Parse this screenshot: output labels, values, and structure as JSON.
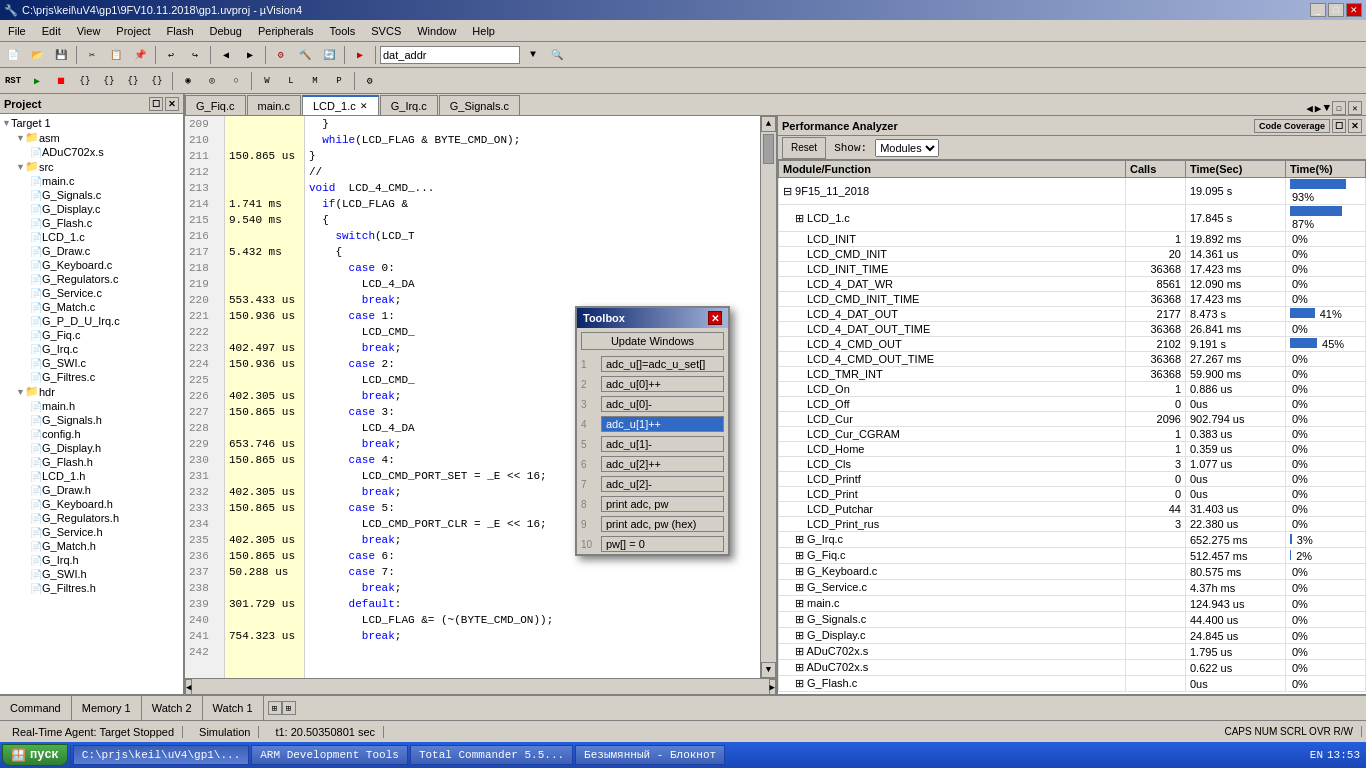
{
  "title": "C:\\prjs\\keil\\uV4\\gp1\\9FV10.11.2018\\gp1.uvproj - µVision4",
  "menu": {
    "items": [
      "File",
      "Edit",
      "View",
      "Project",
      "Flash",
      "Debug",
      "Peripherals",
      "Tools",
      "SVCS",
      "Window",
      "Help"
    ]
  },
  "toolbar1": {
    "combo_value": "dat_addr"
  },
  "project_panel": {
    "title": "Project",
    "tree": [
      {
        "indent": 0,
        "type": "target",
        "label": "Target 1",
        "expanded": true
      },
      {
        "indent": 1,
        "type": "folder",
        "label": "asm",
        "expanded": true
      },
      {
        "indent": 2,
        "type": "file",
        "label": "ADuC702x.s"
      },
      {
        "indent": 1,
        "type": "folder",
        "label": "src",
        "expanded": true
      },
      {
        "indent": 2,
        "type": "file",
        "label": "main.c"
      },
      {
        "indent": 2,
        "type": "file",
        "label": "G_Signals.c"
      },
      {
        "indent": 2,
        "type": "file",
        "label": "G_Display.c"
      },
      {
        "indent": 2,
        "type": "file",
        "label": "G_Flash.c"
      },
      {
        "indent": 2,
        "type": "file",
        "label": "LCD_1.c"
      },
      {
        "indent": 2,
        "type": "file",
        "label": "G_Draw.c"
      },
      {
        "indent": 2,
        "type": "file",
        "label": "G_Keyboard.c"
      },
      {
        "indent": 2,
        "type": "file",
        "label": "G_Regulators.c"
      },
      {
        "indent": 2,
        "type": "file",
        "label": "G_Service.c"
      },
      {
        "indent": 2,
        "type": "file",
        "label": "G_Match.c"
      },
      {
        "indent": 2,
        "type": "file",
        "label": "G_P_D_U_Irq.c"
      },
      {
        "indent": 2,
        "type": "file",
        "label": "G_Fiq.c"
      },
      {
        "indent": 2,
        "type": "file",
        "label": "G_Irq.c"
      },
      {
        "indent": 2,
        "type": "file",
        "label": "G_SWI.c"
      },
      {
        "indent": 2,
        "type": "file",
        "label": "G_Filtres.c"
      },
      {
        "indent": 1,
        "type": "folder",
        "label": "hdr",
        "expanded": true
      },
      {
        "indent": 2,
        "type": "file",
        "label": "main.h"
      },
      {
        "indent": 2,
        "type": "file",
        "label": "G_Signals.h"
      },
      {
        "indent": 2,
        "type": "file",
        "label": "config.h"
      },
      {
        "indent": 2,
        "type": "file",
        "label": "G_Display.h"
      },
      {
        "indent": 2,
        "type": "file",
        "label": "G_Flash.h"
      },
      {
        "indent": 2,
        "type": "file",
        "label": "LCD_1.h"
      },
      {
        "indent": 2,
        "type": "file",
        "label": "G_Draw.h"
      },
      {
        "indent": 2,
        "type": "file",
        "label": "G_Keyboard.h"
      },
      {
        "indent": 2,
        "type": "file",
        "label": "G_Regulators.h"
      },
      {
        "indent": 2,
        "type": "file",
        "label": "G_Service.h"
      },
      {
        "indent": 2,
        "type": "file",
        "label": "G_Match.h"
      },
      {
        "indent": 2,
        "type": "file",
        "label": "G_Irq.h"
      },
      {
        "indent": 2,
        "type": "file",
        "label": "G_SWI.h"
      },
      {
        "indent": 2,
        "type": "file",
        "label": "G_Filtres.h"
      }
    ]
  },
  "tabs": [
    {
      "label": "G_Fiq.c",
      "active": false
    },
    {
      "label": "main.c",
      "active": false
    },
    {
      "label": "LCD_1.c",
      "active": true
    },
    {
      "label": "G_Irq.c",
      "active": false
    },
    {
      "label": "G_Signals.c",
      "active": false
    }
  ],
  "code": {
    "lines": [
      {
        "num": "209",
        "time": "",
        "text": "  }"
      },
      {
        "num": "210",
        "time": "",
        "text": "  while(LCD_FLAG & BYTE_CMD_ON);"
      },
      {
        "num": "211",
        "time": "150.865 us",
        "text": "}"
      },
      {
        "num": "212",
        "time": "",
        "text": "//"
      },
      {
        "num": "213",
        "time": "",
        "text": "void  LCD_4_CMD_..."
      },
      {
        "num": "214",
        "time": "1.741 ms",
        "text": "  if(LCD_FLAG &"
      },
      {
        "num": "215",
        "time": "9.540 ms",
        "text": "  {"
      },
      {
        "num": "216",
        "time": "",
        "text": "    switch(LCD_T"
      },
      {
        "num": "217",
        "time": "5.432 ms",
        "text": "    {"
      },
      {
        "num": "218",
        "time": "",
        "text": "      case 0:"
      },
      {
        "num": "219",
        "time": "",
        "text": "        LCD_4_DA"
      },
      {
        "num": "220",
        "time": "553.433 us",
        "text": "        break;"
      },
      {
        "num": "221",
        "time": "150.936 us",
        "text": "      case 1:"
      },
      {
        "num": "222",
        "time": "",
        "text": "        LCD_CMD_"
      },
      {
        "num": "223",
        "time": "402.497 us",
        "text": "        break;"
      },
      {
        "num": "224",
        "time": "150.936 us",
        "text": "      case 2:"
      },
      {
        "num": "225",
        "time": "",
        "text": "        LCD_CMD_"
      },
      {
        "num": "226",
        "time": "402.305 us",
        "text": "        break;"
      },
      {
        "num": "227",
        "time": "150.865 us",
        "text": "      case 3:"
      },
      {
        "num": "228",
        "time": "",
        "text": "        LCD_4_DA"
      },
      {
        "num": "229",
        "time": "653.746 us",
        "text": "        break;"
      },
      {
        "num": "230",
        "time": "150.865 us",
        "text": "      case 4:"
      },
      {
        "num": "231",
        "time": "",
        "text": "        LCD_CMD_PORT_SET = _E << 16;"
      },
      {
        "num": "232",
        "time": "402.305 us",
        "text": "        break;"
      },
      {
        "num": "233",
        "time": "150.865 us",
        "text": "      case 5:"
      },
      {
        "num": "234",
        "time": "",
        "text": "        LCD_CMD_PORT_CLR = _E << 16;"
      },
      {
        "num": "235",
        "time": "402.305 us",
        "text": "        break;"
      },
      {
        "num": "236",
        "time": "150.865 us",
        "text": "      case 6:"
      },
      {
        "num": "237",
        "time": "50.288 us",
        "text": "      case 7:"
      },
      {
        "num": "238",
        "time": "",
        "text": "        break;"
      },
      {
        "num": "239",
        "time": "301.729 us",
        "text": "      default:"
      },
      {
        "num": "240",
        "time": "",
        "text": "        LCD_FLAG &= (~(BYTE_CMD_ON));"
      },
      {
        "num": "241",
        "time": "754.323 us",
        "text": "        break;"
      },
      {
        "num": "242",
        "time": "",
        "text": ""
      }
    ]
  },
  "toolbox": {
    "title": "Toolbox",
    "update_label": "Update Windows",
    "items": [
      {
        "num": "1",
        "label": "adc_u[]=adc_u_set[]"
      },
      {
        "num": "2",
        "label": "adc_u[0]++"
      },
      {
        "num": "3",
        "label": "adc_u[0]-"
      },
      {
        "num": "4",
        "label": "adc_u[1]++"
      },
      {
        "num": "5",
        "label": "adc_u[1]-"
      },
      {
        "num": "6",
        "label": "adc_u[2]++"
      },
      {
        "num": "7",
        "label": "adc_u[2]-"
      },
      {
        "num": "8",
        "label": "print adc, pw"
      },
      {
        "num": "9",
        "label": "print adc, pw (hex)"
      },
      {
        "num": "10",
        "label": "pw[] = 0"
      }
    ]
  },
  "perf": {
    "title": "Performance Analyzer",
    "show_label": "Show:",
    "show_value": "Modules",
    "reset_label": "Reset",
    "columns": [
      "Module/Function",
      "Calls",
      "Time(Sec)",
      "Time(%)"
    ],
    "rows": [
      {
        "indent": 0,
        "label": "9F15_11_2018",
        "calls": "",
        "time_sec": "19.095 s",
        "time_pct": "93%",
        "bar": 93
      },
      {
        "indent": 1,
        "label": "LCD_1.c",
        "calls": "",
        "time_sec": "17.845 s",
        "time_pct": "87%",
        "bar": 87
      },
      {
        "indent": 2,
        "label": "LCD_INIT",
        "calls": "1",
        "time_sec": "19.892 ms",
        "time_pct": "0%",
        "bar": 0
      },
      {
        "indent": 2,
        "label": "LCD_CMD_INIT",
        "calls": "20",
        "time_sec": "14.361 us",
        "time_pct": "0%",
        "bar": 0
      },
      {
        "indent": 2,
        "label": "LCD_INIT_TIME",
        "calls": "36368",
        "time_sec": "17.423 ms",
        "time_pct": "0%",
        "bar": 0
      },
      {
        "indent": 2,
        "label": "LCD_4_DAT_WR",
        "calls": "8561",
        "time_sec": "12.090 ms",
        "time_pct": "0%",
        "bar": 0
      },
      {
        "indent": 2,
        "label": "LCD_CMD_INIT_TIME",
        "calls": "36368",
        "time_sec": "17.423 ms",
        "time_pct": "0%",
        "bar": 0
      },
      {
        "indent": 2,
        "label": "LCD_4_DAT_OUT",
        "calls": "2177",
        "time_sec": "8.473 s",
        "time_pct": "41%",
        "bar": 41
      },
      {
        "indent": 2,
        "label": "LCD_4_DAT_OUT_TIME",
        "calls": "36368",
        "time_sec": "26.841 ms",
        "time_pct": "0%",
        "bar": 0
      },
      {
        "indent": 2,
        "label": "LCD_4_CMD_OUT",
        "calls": "2102",
        "time_sec": "9.191 s",
        "time_pct": "45%",
        "bar": 45
      },
      {
        "indent": 2,
        "label": "LCD_4_CMD_OUT_TIME",
        "calls": "36368",
        "time_sec": "27.267 ms",
        "time_pct": "0%",
        "bar": 0
      },
      {
        "indent": 2,
        "label": "LCD_TMR_INT",
        "calls": "36368",
        "time_sec": "59.900 ms",
        "time_pct": "0%",
        "bar": 0
      },
      {
        "indent": 2,
        "label": "LCD_On",
        "calls": "1",
        "time_sec": "0.886 us",
        "time_pct": "0%",
        "bar": 0
      },
      {
        "indent": 2,
        "label": "LCD_Off",
        "calls": "0",
        "time_sec": "0us",
        "time_pct": "0%",
        "bar": 0
      },
      {
        "indent": 2,
        "label": "LCD_Cur",
        "calls": "2096",
        "time_sec": "902.794 us",
        "time_pct": "0%",
        "bar": 0
      },
      {
        "indent": 2,
        "label": "LCD_Cur_CGRAM",
        "calls": "1",
        "time_sec": "0.383 us",
        "time_pct": "0%",
        "bar": 0
      },
      {
        "indent": 2,
        "label": "LCD_Home",
        "calls": "1",
        "time_sec": "0.359 us",
        "time_pct": "0%",
        "bar": 0
      },
      {
        "indent": 2,
        "label": "LCD_Cls",
        "calls": "3",
        "time_sec": "1.077 us",
        "time_pct": "0%",
        "bar": 0
      },
      {
        "indent": 2,
        "label": "LCD_Printf",
        "calls": "0",
        "time_sec": "0us",
        "time_pct": "0%",
        "bar": 0
      },
      {
        "indent": 2,
        "label": "LCD_Print",
        "calls": "0",
        "time_sec": "0us",
        "time_pct": "0%",
        "bar": 0
      },
      {
        "indent": 2,
        "label": "LCD_Putchar",
        "calls": "44",
        "time_sec": "31.403 us",
        "time_pct": "0%",
        "bar": 0
      },
      {
        "indent": 2,
        "label": "LCD_Print_rus",
        "calls": "3",
        "time_sec": "22.380 us",
        "time_pct": "0%",
        "bar": 0
      },
      {
        "indent": 1,
        "label": "G_Irq.c",
        "calls": "",
        "time_sec": "652.275 ms",
        "time_pct": "3%",
        "bar": 3
      },
      {
        "indent": 1,
        "label": "G_Fiq.c",
        "calls": "",
        "time_sec": "512.457 ms",
        "time_pct": "2%",
        "bar": 2
      },
      {
        "indent": 1,
        "label": "G_Keyboard.c",
        "calls": "",
        "time_sec": "80.575 ms",
        "time_pct": "0%",
        "bar": 0
      },
      {
        "indent": 1,
        "label": "G_Service.c",
        "calls": "",
        "time_sec": "4.37h ms",
        "time_pct": "0%",
        "bar": 0
      },
      {
        "indent": 1,
        "label": "main.c",
        "calls": "",
        "time_sec": "124.943 us",
        "time_pct": "0%",
        "bar": 0
      },
      {
        "indent": 1,
        "label": "G_Signals.c",
        "calls": "",
        "time_sec": "44.400 us",
        "time_pct": "0%",
        "bar": 0
      },
      {
        "indent": 1,
        "label": "G_Display.c",
        "calls": "",
        "time_sec": "24.845 us",
        "time_pct": "0%",
        "bar": 0
      },
      {
        "indent": 1,
        "label": "ADuC702x.s",
        "calls": "",
        "time_sec": "1.795 us",
        "time_pct": "0%",
        "bar": 0
      },
      {
        "indent": 1,
        "label": "ADuC702x.s",
        "calls": "",
        "time_sec": "0.622 us",
        "time_pct": "0%",
        "bar": 0
      },
      {
        "indent": 1,
        "label": "G_Flash.c",
        "calls": "",
        "time_sec": "0us",
        "time_pct": "0%",
        "bar": 0
      }
    ]
  },
  "bottom_tabs": [
    "Watch 1",
    "Watch 2",
    "Memory 1",
    "Command"
  ],
  "status": {
    "agent": "Real-Time Agent: Target Stopped",
    "mode": "Simulation",
    "time": "t1: 20.50350801 sec",
    "caps": "CAPS NUM SCRL OVR R/W"
  },
  "taskbar": {
    "start": "пуск",
    "items": [
      "C:\\prjs\\keil\\uV4\\gp1\\...",
      "ARM Development Tools",
      "Total Commander 5.5...",
      "Безымянный - Блокнот"
    ],
    "time": "13:53",
    "lang": "EN"
  }
}
